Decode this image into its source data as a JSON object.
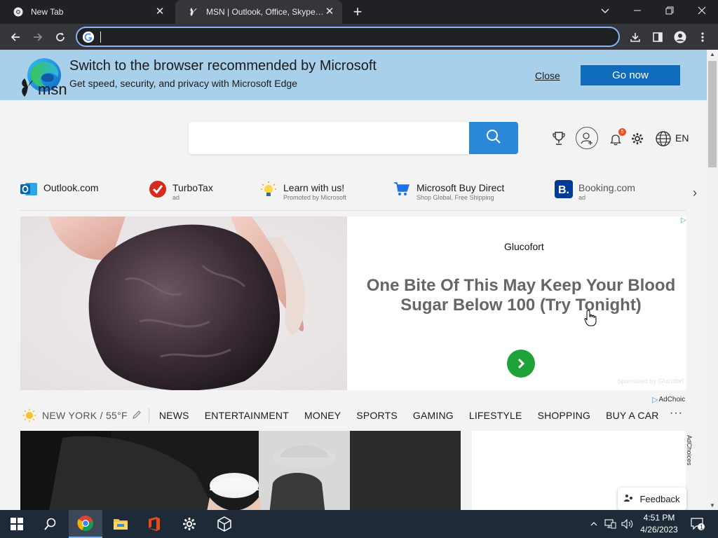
{
  "browser": {
    "tabs": [
      {
        "title": "New Tab",
        "active": false
      },
      {
        "title": "MSN | Outlook, Office, Skype, Bing, Breaking News, and Latest Videos",
        "active": true
      }
    ],
    "address_bar": {
      "value": "",
      "placeholder": ""
    }
  },
  "edge_banner": {
    "title": "Switch to the browser recommended by Microsoft",
    "subtitle": "Get speed, security, and privacy with Microsoft Edge",
    "close_label": "Close",
    "go_label": "Go now"
  },
  "msn": {
    "logo_text": "msn",
    "search_value": "",
    "notification_count": "5",
    "language": "EN"
  },
  "top_sites": [
    {
      "name": "Outlook.com",
      "sub": ""
    },
    {
      "name": "TurboTax",
      "sub": "ad"
    },
    {
      "name": "Learn with us!",
      "sub": "Promoted by Microsoft"
    },
    {
      "name": "Microsoft Buy Direct",
      "sub": "Shop Global, Free Shipping"
    },
    {
      "name": "Booking.com",
      "sub": "ad"
    }
  ],
  "ad": {
    "brand": "Glucofort",
    "headline": "One Bite Of This May Keep Your Blood Sugar Below 100 (Try Tonight)",
    "sponsored": "Sponsored by Glucofort",
    "adchoices": "AdChoic",
    "adchoices_side": "AdChoices"
  },
  "weather": {
    "location": "NEW YORK / 55°F"
  },
  "categories": [
    "NEWS",
    "ENTERTAINMENT",
    "MONEY",
    "SPORTS",
    "GAMING",
    "LIFESTYLE",
    "SHOPPING",
    "BUY A CAR"
  ],
  "feedback_label": "Feedback",
  "taskbar": {
    "time": "4:51 PM",
    "date": "4/26/2023",
    "notification_count": "1"
  },
  "colors": {
    "banner_bg": "#a9d0ea",
    "go_button": "#0f6cbd",
    "search_button": "#2b88d8",
    "ad_cta": "#1fa338"
  }
}
